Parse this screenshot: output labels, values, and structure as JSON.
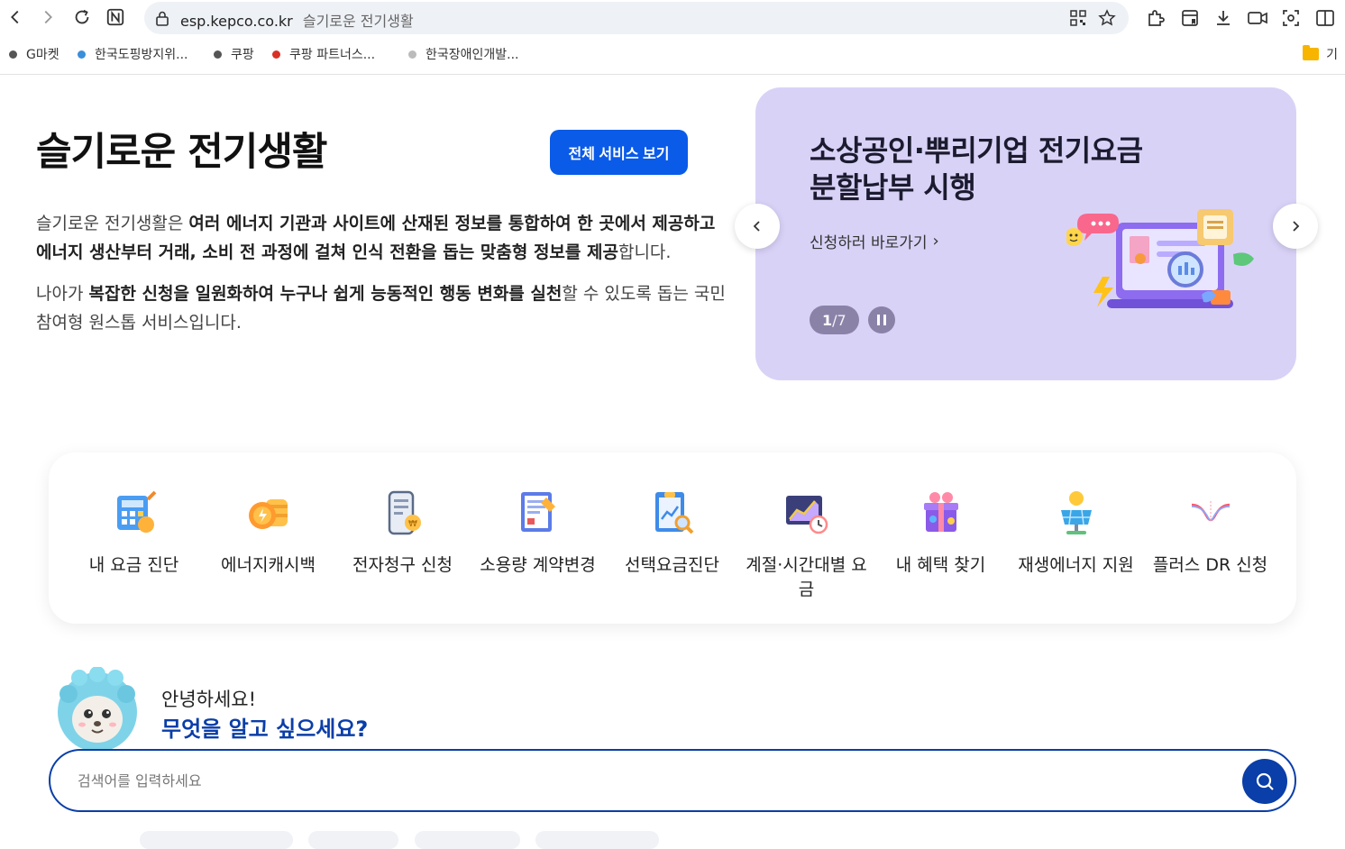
{
  "browser": {
    "url_host": "esp.kepco.co.kr",
    "page_title": "슬기로운 전기생활",
    "bookmarks": [
      {
        "label": "G마켓",
        "color": "#555555"
      },
      {
        "label": "한국도핑방지위...",
        "color": "#3a8fd9"
      },
      {
        "label": "쿠팡",
        "color": "#555555"
      },
      {
        "label": "쿠팡 파트너스...",
        "color": "#d93025"
      },
      {
        "label": "한국장애인개발...",
        "color": "#bbbbbb"
      }
    ],
    "bookmark_folder": "기"
  },
  "hero": {
    "title": "슬기로운 전기생활",
    "all_services_label": "전체 서비스 보기",
    "p1_a": "슬기로운 전기생활은 ",
    "p1_b": "여러 에너지 기관과 사이트에 산재된 정보를 통합하여 한 곳에서 제공하고",
    "p1_c": "에너지 생산부터 거래, 소비 전 과정에 걸쳐 인식 전환을 돕는 맞춤형 정보를 제공",
    "p1_d": "합니다.",
    "p2_a": "나아가 ",
    "p2_b": "복잡한 신청을 일원화하여 누구나 쉽게 능동적인 행동 변화를 실천",
    "p2_c": "할 수 있도록 돕는 국민",
    "p2_d": "참여형 원스톱 서비스입니다."
  },
  "banner": {
    "title_line1": "소상공인·뿌리기업 전기요금",
    "title_line2": "분할납부 시행",
    "link_label": "신청하러 바로가기",
    "page_current": "1",
    "page_total": "/7",
    "bg_color": "#d9d2f7"
  },
  "quick_menu": [
    {
      "label": "내 요금 진단",
      "icon": "bill-calculator-icon"
    },
    {
      "label": "에너지캐시백",
      "icon": "coin-cashback-icon"
    },
    {
      "label": "전자청구 신청",
      "icon": "e-bill-phone-icon"
    },
    {
      "label": "소용량 계약변경",
      "icon": "contract-document-icon"
    },
    {
      "label": "선택요금진단",
      "icon": "report-magnifier-icon"
    },
    {
      "label": "계절·시간대별 요금",
      "icon": "chart-clock-icon"
    },
    {
      "label": "내 혜택 찾기",
      "icon": "gift-box-icon"
    },
    {
      "label": "재생에너지 지원",
      "icon": "solar-panel-icon"
    },
    {
      "label": "플러스 DR 신청",
      "icon": "dr-curve-icon"
    }
  ],
  "assistant": {
    "greeting": "안녕하세요!",
    "question": "무엇을 알고 싶으세요?",
    "search_placeholder": "검색어를 입력하세요"
  },
  "colors": {
    "primary_blue": "#0a5be8",
    "navy": "#0a3ea8"
  }
}
